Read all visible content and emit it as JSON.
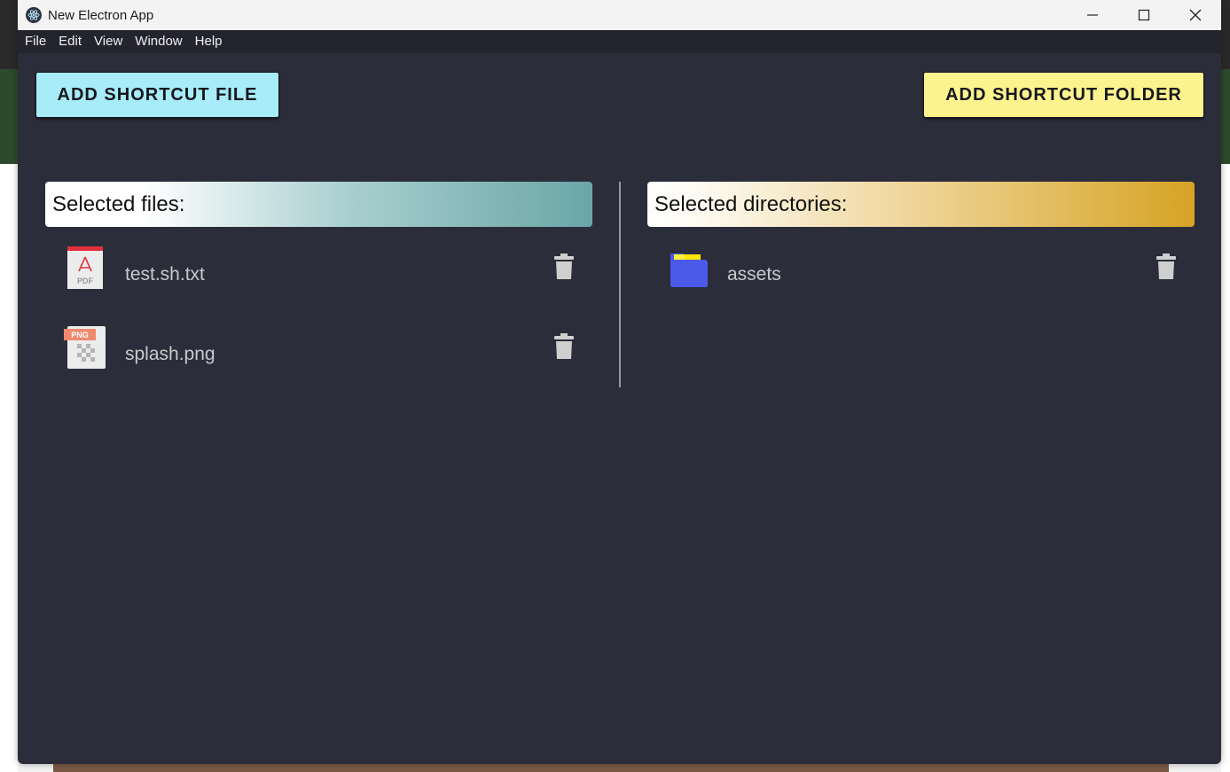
{
  "window": {
    "title": "New Electron App"
  },
  "menu": [
    "File",
    "Edit",
    "View",
    "Window",
    "Help"
  ],
  "buttons": {
    "add_file": "ADD SHORTCUT FILE",
    "add_folder": "ADD SHORTCUT FOLDER"
  },
  "files": {
    "header": "Selected files:",
    "items": [
      {
        "name": "test.sh.txt",
        "icon": "pdf-file-icon"
      },
      {
        "name": "splash.png",
        "icon": "png-file-icon"
      }
    ]
  },
  "dirs": {
    "header": "Selected directories:",
    "items": [
      {
        "name": "assets",
        "icon": "folder-icon"
      }
    ]
  },
  "colors": {
    "background": "#2c2d3b",
    "add_file_button": "#a7ecf8",
    "add_folder_button": "#fdf38e",
    "files_header_end": "#6aa6a6",
    "dirs_header_end": "#d6a324"
  }
}
